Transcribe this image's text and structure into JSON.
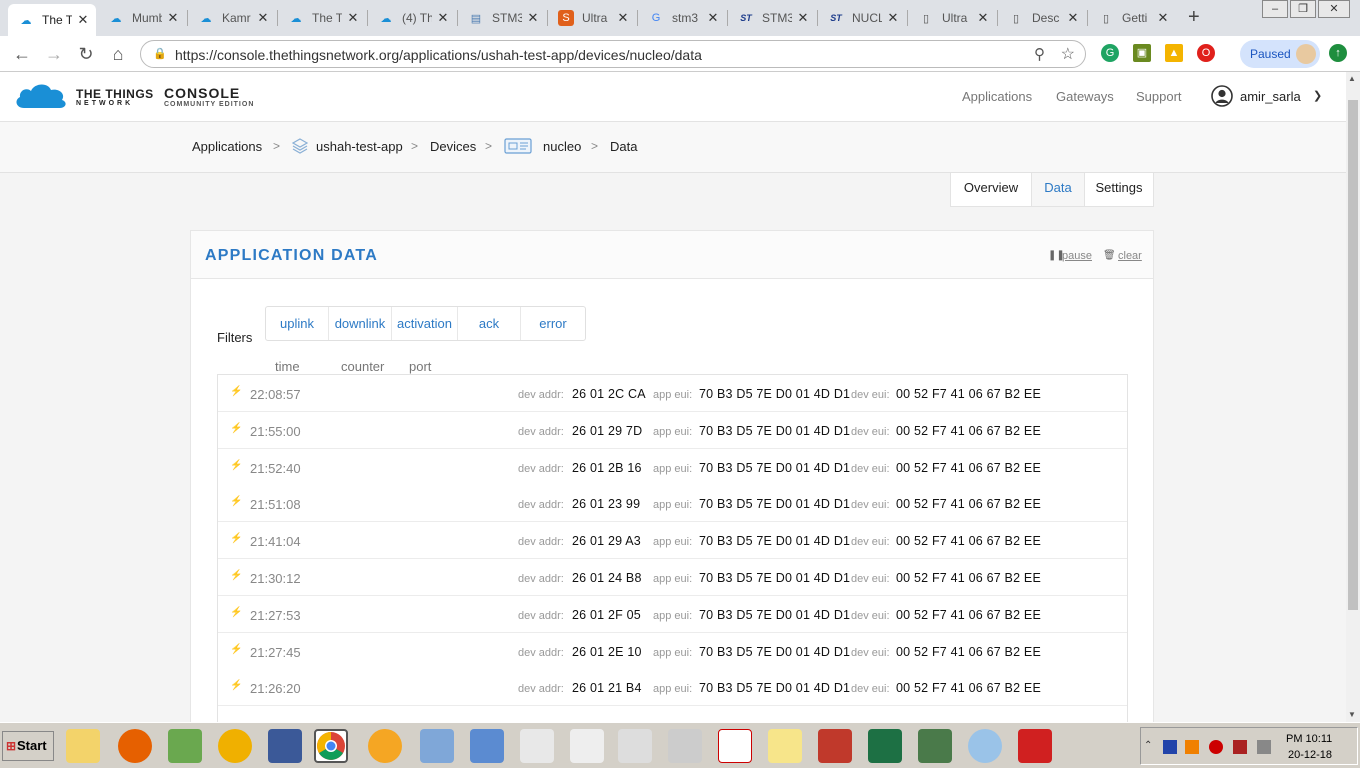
{
  "browser": {
    "tabs": [
      {
        "title": "The T",
        "icon": "ttn-cloud-icon",
        "active": true
      },
      {
        "title": "Mumb",
        "icon": "ttn-cloud-icon"
      },
      {
        "title": "Kamr",
        "icon": "ttn-cloud-icon"
      },
      {
        "title": "The T",
        "icon": "ttn-cloud-icon"
      },
      {
        "title": "(4) Th",
        "icon": "ttn-cloud-icon"
      },
      {
        "title": "STM3",
        "icon": "stm-book-icon"
      },
      {
        "title": "Ultra",
        "icon": "ultra-s-icon"
      },
      {
        "title": "stm3",
        "icon": "google-g-icon"
      },
      {
        "title": "STM3",
        "icon": "st-logo-icon"
      },
      {
        "title": "NUCL",
        "icon": "st-logo-icon"
      },
      {
        "title": "Ultra",
        "icon": "document-icon"
      },
      {
        "title": "Desc",
        "icon": "document-icon"
      },
      {
        "title": "Getti",
        "icon": "document-icon"
      }
    ],
    "tab_close_glyph": "✕",
    "new_tab_glyph": "+",
    "url": "https://console.thethingsnetwork.org/applications/ushah-test-app/devices/nucleo/data",
    "paused_label": "Paused"
  },
  "header": {
    "logo_line1": "THE THINGS",
    "logo_line2": "NETWORK",
    "console_line1": "CONSOLE",
    "console_line2": "COMMUNITY EDITION",
    "nav": [
      "Applications",
      "Gateways",
      "Support"
    ],
    "username": "amir_sarla"
  },
  "breadcrumb": {
    "applications": "Applications",
    "app": "ushah-test-app",
    "devices": "Devices",
    "device": "nucleo",
    "current": "Data",
    "separator": ">"
  },
  "subtabs": [
    "Overview",
    "Data",
    "Settings"
  ],
  "card": {
    "title": "APPLICATION DATA",
    "pause_label": "pause",
    "clear_label": "clear",
    "filters_label": "Filters",
    "filters": [
      "uplink",
      "downlink",
      "activation",
      "ack",
      "error"
    ],
    "columns": [
      "time",
      "counter",
      "port"
    ],
    "label_dev_addr": "dev addr:",
    "label_app_eui": "app eui:",
    "label_dev_eui": "dev eui:",
    "rows": [
      {
        "time": "22:08:57",
        "dev_addr": "26 01 2C CA",
        "app_eui": "70 B3 D5 7E D0 01 4D D1",
        "dev_eui": "00 52 F7 41 06 67 B2 EE"
      },
      {
        "time": "21:55:00",
        "dev_addr": "26 01 29 7D",
        "app_eui": "70 B3 D5 7E D0 01 4D D1",
        "dev_eui": "00 52 F7 41 06 67 B2 EE"
      },
      {
        "time": "21:52:40",
        "dev_addr": "26 01 2B 16",
        "app_eui": "70 B3 D5 7E D0 01 4D D1",
        "dev_eui": "00 52 F7 41 06 67 B2 EE"
      },
      {
        "time": "21:51:08",
        "dev_addr": "26 01 23 99",
        "app_eui": "70 B3 D5 7E D0 01 4D D1",
        "dev_eui": "00 52 F7 41 06 67 B2 EE"
      },
      {
        "time": "21:41:04",
        "dev_addr": "26 01 29 A3",
        "app_eui": "70 B3 D5 7E D0 01 4D D1",
        "dev_eui": "00 52 F7 41 06 67 B2 EE"
      },
      {
        "time": "21:30:12",
        "dev_addr": "26 01 24 B8",
        "app_eui": "70 B3 D5 7E D0 01 4D D1",
        "dev_eui": "00 52 F7 41 06 67 B2 EE"
      },
      {
        "time": "21:27:53",
        "dev_addr": "26 01 2F 05",
        "app_eui": "70 B3 D5 7E D0 01 4D D1",
        "dev_eui": "00 52 F7 41 06 67 B2 EE"
      },
      {
        "time": "21:27:45",
        "dev_addr": "26 01 2E 10",
        "app_eui": "70 B3 D5 7E D0 01 4D D1",
        "dev_eui": "00 52 F7 41 06 67 B2 EE"
      },
      {
        "time": "21:26:20",
        "dev_addr": "26 01 21 B4",
        "app_eui": "70 B3 D5 7E D0 01 4D D1",
        "dev_eui": "00 52 F7 41 06 67 B2 EE"
      }
    ]
  },
  "taskbar": {
    "start_label": "Start",
    "clock_time": "PM 10:11",
    "clock_date": "20-12-18"
  },
  "colors": {
    "accent": "#2d7ac5",
    "uplink_bolt": "#f2b21b",
    "ttn_blue": "#1a8fd6"
  }
}
